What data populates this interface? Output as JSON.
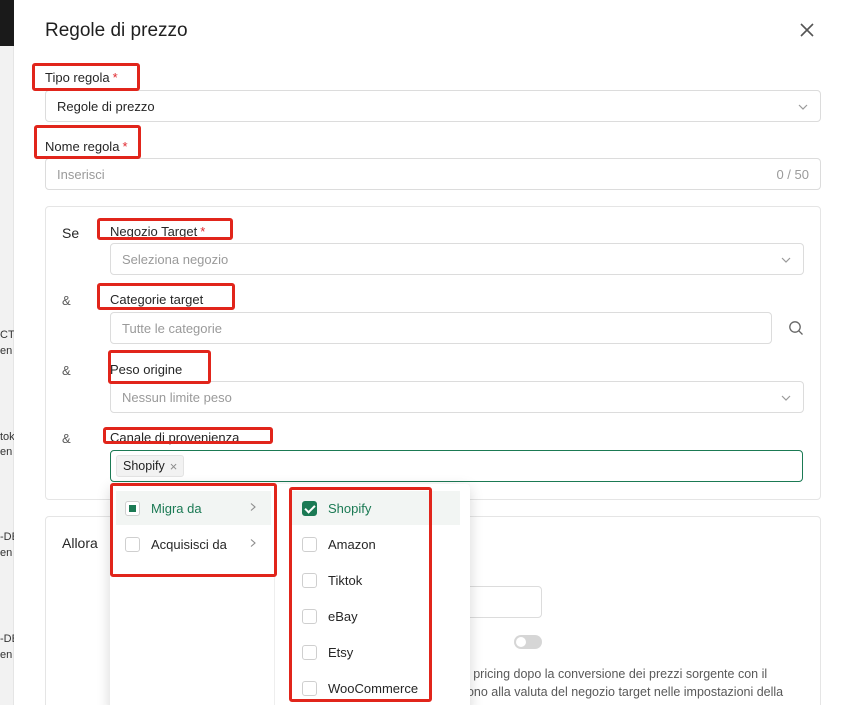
{
  "background": {
    "fragments": [
      "CTO",
      "en",
      "tok",
      "en",
      "-DE",
      "en",
      "-DE",
      "en"
    ]
  },
  "dialog": {
    "title": "Regole di prezzo",
    "close_icon": "close-icon"
  },
  "form": {
    "rule_type": {
      "label": "Tipo regola",
      "required": "*",
      "value": "Regole di prezzo"
    },
    "rule_name": {
      "label": "Nome regola",
      "required": "*",
      "placeholder": "Inserisci",
      "counter": "0 / 50"
    }
  },
  "conditions": {
    "if_label": "Se",
    "and_label": "&",
    "target_store": {
      "label": "Negozio Target",
      "required": "*",
      "placeholder": "Seleziona negozio"
    },
    "target_categories": {
      "label": "Categorie target",
      "placeholder": "Tutte le categorie"
    },
    "origin_weight": {
      "label": "Peso origine",
      "placeholder": "Nessun limite peso"
    },
    "source_channel": {
      "label": "Canale di provenienza",
      "tags": [
        "Shopify"
      ]
    }
  },
  "then": {
    "label": "Allora",
    "desc_line1": "di pricing dopo la conversione dei prezzi sorgente con il",
    "desc_line2": "dono alla valuta del negozio target nelle impostazioni della"
  },
  "cascader": {
    "level1": [
      {
        "label": "Migra da",
        "state": "partial",
        "active": true
      },
      {
        "label": "Acquisisci da",
        "state": "unchecked",
        "active": false
      }
    ],
    "level2": [
      {
        "label": "Shopify",
        "state": "checked"
      },
      {
        "label": "Amazon",
        "state": "unchecked"
      },
      {
        "label": "Tiktok",
        "state": "unchecked"
      },
      {
        "label": "eBay",
        "state": "unchecked"
      },
      {
        "label": "Etsy",
        "state": "unchecked"
      },
      {
        "label": "WooCommerce",
        "state": "unchecked"
      }
    ]
  },
  "colors": {
    "accent": "#1b7a54",
    "required": "#e0282e",
    "highlight_box": "#e1251b"
  }
}
